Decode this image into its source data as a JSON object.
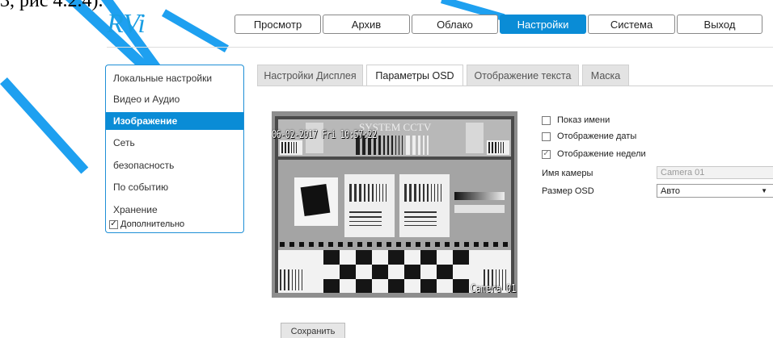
{
  "top_text": "3, рис 4.2.4).",
  "logo": {
    "text": "RVi",
    "color": "#1a9ee3"
  },
  "nav": {
    "items": [
      {
        "label": "Просмотр",
        "active": false
      },
      {
        "label": "Архив",
        "active": false
      },
      {
        "label": "Облако",
        "active": false
      },
      {
        "label": "Настройки",
        "active": true
      },
      {
        "label": "Система",
        "active": false
      },
      {
        "label": "Выход",
        "active": false
      }
    ]
  },
  "sidebar": {
    "items": [
      {
        "label": "Локальные настройки",
        "active": false
      },
      {
        "label": "Видео и Аудио",
        "active": false
      },
      {
        "label": "Изображение",
        "active": true
      },
      {
        "label": "Сеть",
        "active": false
      },
      {
        "label": "безопасность",
        "active": false
      },
      {
        "label": "По событию",
        "active": false
      },
      {
        "label": "Хранение",
        "active": false
      }
    ],
    "extra": {
      "label": "Дополнительно",
      "checked": true,
      "mark": "✓"
    }
  },
  "tabs": [
    {
      "label": "Настройки Дисплея",
      "active": false
    },
    {
      "label": "Параметры OSD",
      "active": true
    },
    {
      "label": "Отображение текста",
      "active": false
    },
    {
      "label": "Маска",
      "active": false
    }
  ],
  "preview": {
    "osd_datetime": "06-02-2017 Fri 10:57:22",
    "osd_camera": "Camera 01",
    "watermark": "SYSTEM CCTV"
  },
  "options": [
    {
      "label": "Показ имени",
      "checked": false,
      "mark": ""
    },
    {
      "label": "Отображение даты",
      "checked": false,
      "mark": ""
    },
    {
      "label": "Отображение недели",
      "checked": true,
      "mark": "✓"
    }
  ],
  "camera_name": {
    "label": "Имя камеры",
    "value": "Camera 01"
  },
  "osd_size": {
    "label": "Размер OSD",
    "value": "Авто",
    "arrow": "▼"
  },
  "save_label": "Сохранить",
  "colors": {
    "accent": "#0a8cd6",
    "stripe": "#1ea0f0"
  }
}
